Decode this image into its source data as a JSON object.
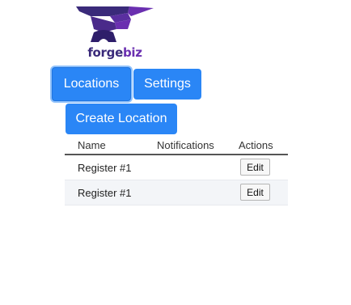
{
  "logo": {
    "word_part1": "forge",
    "word_part2": "biz",
    "colors": {
      "dark": "#3a2a7a",
      "light": "#6a2fb0"
    },
    "icon": "anvil-icon"
  },
  "nav": {
    "locations_label": "Locations",
    "settings_label": "Settings"
  },
  "actions": {
    "create_label": "Create Location"
  },
  "table": {
    "headers": [
      "Name",
      "Notifications",
      "Actions"
    ],
    "rows": [
      {
        "name": "Register #1",
        "notifications": "",
        "action": "Edit"
      },
      {
        "name": "Register #1",
        "notifications": "",
        "action": "Edit"
      }
    ]
  },
  "colors": {
    "primary": "#2a86f6",
    "row_alt": "#f3f5f8"
  }
}
